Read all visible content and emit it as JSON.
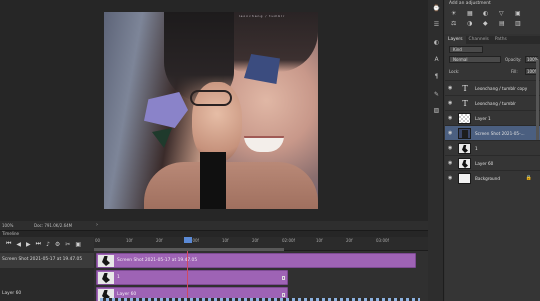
{
  "canvas": {
    "caption": "leonchang / tumblr",
    "zoom": "100%",
    "doc_info": "Doc: 791.0K/2.64M"
  },
  "timeline": {
    "title": "Timeline",
    "ruler_ticks": [
      "00",
      "10f",
      "20f",
      "01:00f",
      "10f",
      "20f",
      "02:00f",
      "10f",
      "20f",
      "03:00f"
    ],
    "tracks": [
      {
        "label": "Screen Shot 2021-05-17 at 19.47.05",
        "clip": "Screen Shot 2021-05-17 at 19.47.05"
      },
      {
        "label": "",
        "clip": "1"
      },
      {
        "label": "Layer 60",
        "clip": "Layer 60"
      }
    ]
  },
  "adjustments": {
    "title": "Add an adjustment",
    "icons": [
      "☀",
      "▦",
      "◐",
      "▽",
      "▣",
      "⚖",
      "◑",
      "◆",
      "▤",
      "▥"
    ]
  },
  "layers_panel": {
    "tabs": [
      "Layers",
      "Channels",
      "Paths"
    ],
    "kind": "Kind",
    "blend_mode": "Normal",
    "opacity_label": "Opacity:",
    "opacity": "100%",
    "lock_label": "Lock:",
    "fill_label": "Fill:",
    "fill": "100%",
    "layers": [
      {
        "name": "Leonchang / tumblr copy",
        "type": "text"
      },
      {
        "name": "Leonchang / tumblr",
        "type": "text"
      },
      {
        "name": "Layer 1",
        "type": "checker"
      },
      {
        "name": "Screen Shot 2021-05-...",
        "type": "photo",
        "selected": true
      },
      {
        "name": "1",
        "type": "fig"
      },
      {
        "name": "Layer 60",
        "type": "fig"
      },
      {
        "name": "Background",
        "type": "white",
        "locked": true
      }
    ]
  }
}
